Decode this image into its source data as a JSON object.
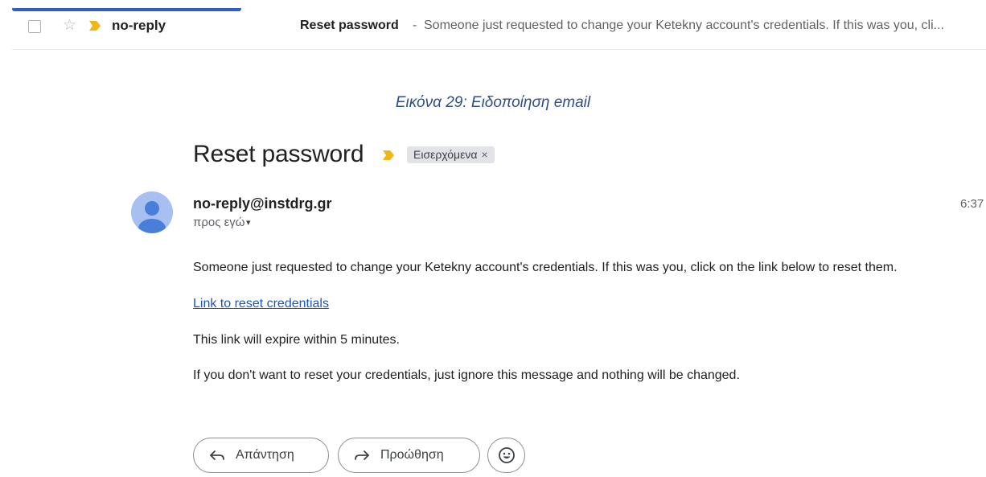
{
  "inbox_row": {
    "sender": "no-reply",
    "subject": "Reset password",
    "snippet_separator": "-",
    "snippet": "Someone just requested to change your Ketekny account's credentials. If this was you, cli..."
  },
  "caption": "Εικόνα 29: Ειδοποίηση email",
  "email": {
    "subject": "Reset password",
    "label": "Εισερχόμενα",
    "label_close": "×",
    "sender_email": "no-reply@instdrg.gr",
    "recipient": "προς εγώ",
    "recipient_caret": "▾",
    "time": "6:37",
    "body": {
      "line1": "Someone just requested to change your Ketekny account's credentials. If this was you, click on the link below to reset them.",
      "link_text": "Link to reset credentials",
      "line2": "This link will expire within 5 minutes.",
      "line3": "If you don't want to reset your credentials, just ignore this message and nothing will be changed."
    }
  },
  "actions": {
    "reply_label": "Απάντηση",
    "forward_label": "Προώθηση"
  },
  "icons": {
    "checkbox": "checkbox-icon",
    "star": "star-icon",
    "important": "important-marker-icon",
    "avatar": "person-avatar-icon",
    "reply": "reply-arrow-icon",
    "forward": "forward-arrow-icon",
    "emoji": "smiley-emoji-icon"
  },
  "colors": {
    "important_marker": "#f2b614",
    "link": "#1a57c0",
    "caption": "#2e4e87",
    "avatar_bg": "#a7c0f1",
    "avatar_fg": "#4a7fd9"
  }
}
